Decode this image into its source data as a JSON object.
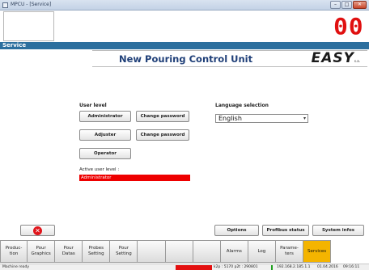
{
  "window": {
    "title": "MPCU - [Service]",
    "controls": [
      "minimize",
      "maximize",
      "close"
    ]
  },
  "display": {
    "value": "00",
    "color": "#e01010"
  },
  "section": {
    "title": "Service"
  },
  "header": {
    "title": "New Pouring Control Unit",
    "logo": "EASY",
    "logo_suffix": "s.a."
  },
  "user_level": {
    "label": "User level",
    "administrator": "Administrator",
    "adjuster": "Adjuster",
    "operator": "Operator",
    "change_password": "Change password",
    "active_label": "Active user level :",
    "active_value": "Administrator"
  },
  "language": {
    "label": "Language selection",
    "value": "English"
  },
  "actions": {
    "options": "Options",
    "profibus": "Profibus status",
    "system": "System infos"
  },
  "tabs": [
    "Produc-\ntion",
    "Pour\nGraphics",
    "Pour\nDatas",
    "Probes\nSetting",
    "Pour\nSetting",
    "",
    "",
    "",
    "Alarms",
    "Log",
    "Parame-\nters",
    "Services"
  ],
  "status": {
    "left": "Machine ready",
    "counters": "k2p : 5170  p2t : 290801",
    "ip": "192.168.2.185.1.1",
    "date": "01.04.2016",
    "time": "09:16:11"
  },
  "colors": {
    "accent_bar": "#2c6f9e",
    "active_tab": "#f4b400",
    "alert": "#ee0000"
  }
}
